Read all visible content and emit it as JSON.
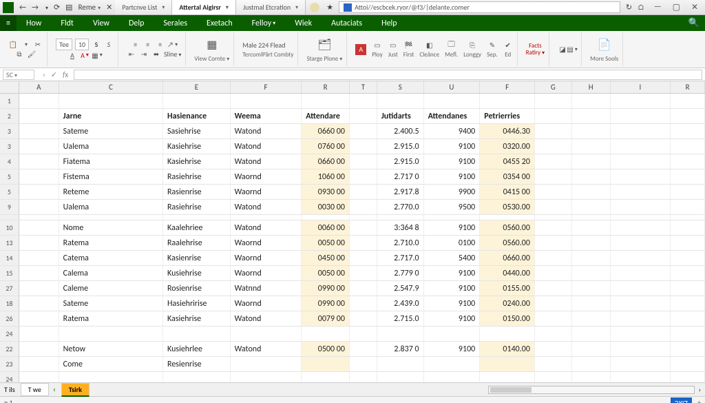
{
  "titlebar": {
    "reme": "Reme",
    "tabs": [
      "Partcnve List",
      "Attertal Aigirsr",
      "Justmal Etcration"
    ],
    "active_tab_index": 1,
    "address": "Attoi//escbcek.ryor/@f3/|delante.comer"
  },
  "ribbon_tabs": [
    "How",
    "Fldt",
    "View",
    "Delp",
    "Serales",
    "Exetach",
    "Felloy",
    "Wiek",
    "Autaciats",
    "Help"
  ],
  "ribbon": {
    "font_name": "Tee",
    "font_size": "10",
    "align_hint": "Sline",
    "view_btn": "View Cornte",
    "male_label": "Male 224 Flead",
    "tercom_label": "TercomlPârt Combty",
    "stage": "Starge Plone",
    "btns": [
      "Ploy",
      "Just",
      "First",
      "Cleânce",
      "Mefl.",
      "Longgy",
      "Sep.",
      "Ed"
    ],
    "facts1": "Facts",
    "facts2": "Ratiry",
    "more": "More Sools"
  },
  "formula": {
    "namebox": "SC"
  },
  "columns": [
    "A",
    "C",
    "E",
    "F",
    "R",
    "T",
    "S",
    "U",
    "F",
    "G",
    "H",
    "I",
    "R"
  ],
  "headers": {
    "jarne": "Jarne",
    "hasienance": "Hasienance",
    "weema": "Weema",
    "attendare": "Attendare",
    "jutidarts": "Jutidarts",
    "attendanes": "Attendanes",
    "petrierries": "Petrierries"
  },
  "rows": [
    {
      "rh": "1",
      "blank": true
    },
    {
      "rh": "2",
      "header": true
    },
    {
      "rh": "3",
      "c": "Sateme",
      "e": "Sasiehrise",
      "f": "Watond",
      "r": "0660 00",
      "s": "2.400.5",
      "u": "9400",
      "ff": "0446.30"
    },
    {
      "rh": "3",
      "c": "Ualema",
      "e": "Kasiehrise",
      "f": "Watond",
      "r": "0760 00",
      "s": "2.915.0",
      "u": "9100",
      "ff": "0320.00"
    },
    {
      "rh": "4",
      "c": "Fiatema",
      "e": "Kasiehrise",
      "f": "Watond",
      "r": "0660 00",
      "s": "2.915.0",
      "u": "9100",
      "ff": "0455 20"
    },
    {
      "rh": "5",
      "c": "Fistema",
      "e": "Rasiehrise",
      "f": "Waornd",
      "r": "1060 00",
      "s": "2.717 0",
      "u": "9100",
      "ff": "0354 00"
    },
    {
      "rh": "5",
      "c": "Reteme",
      "e": "Rasienrise",
      "f": "Waornd",
      "r": "0930 00",
      "s": "2.917.8",
      "u": "9900",
      "ff": "0415 00"
    },
    {
      "rh": "9",
      "c": "Ualema",
      "e": "Rasiehrise",
      "f": "Watond",
      "r": "0030 00",
      "s": "2.770.0",
      "u": "9500",
      "ff": "0530.00"
    },
    {
      "rh": "",
      "blank": true,
      "short": true
    },
    {
      "rh": "10",
      "c": "Nome",
      "e": "Kaalehriee",
      "f": "Watond",
      "r": "0060 00",
      "s": "3:364 8",
      "u": "9100",
      "ff": "0560.00"
    },
    {
      "rh": "13",
      "c": "Ratema",
      "e": "Raalehrise",
      "f": "Waornd",
      "r": "0050 00",
      "s": "2.710.0",
      "u": "0100",
      "ff": "0560.00"
    },
    {
      "rh": "14",
      "c": "Catema",
      "e": "Kasienrise",
      "f": "Waornd",
      "r": "0450 00",
      "s": "2.717.0",
      "u": "5400",
      "ff": "0660.00"
    },
    {
      "rh": "15",
      "c": "Calema",
      "e": "Kusiehrise",
      "f": "Waornd",
      "r": "0050 00",
      "s": "2.779 0",
      "u": "9100",
      "ff": "0440.00"
    },
    {
      "rh": "27",
      "c": "Caleme",
      "e": "Rosienrise",
      "f": "Watnnd",
      "r": "0990 00",
      "s": "2.547.9",
      "u": "9100",
      "ff": "0155.00"
    },
    {
      "rh": "18",
      "c": "Sateme",
      "e": "Hasiehririse",
      "f": "Waornd",
      "r": "0990 00",
      "s": "2.439.0",
      "u": "9100",
      "ff": "0240.00"
    },
    {
      "rh": "26",
      "c": "Ratema",
      "e": "Kasiehrise",
      "f": "Watond",
      "r": "0079 00",
      "s": "2.715.0",
      "u": "9100",
      "ff": "0150.00"
    },
    {
      "rh": "24",
      "blank": true
    },
    {
      "rh": "22",
      "c": "Netow",
      "e": "Kusiehrlee",
      "f": "Watond",
      "r": "0500 00",
      "s": "2.837 0",
      "u": "9100",
      "ff": "0140.00"
    },
    {
      "rh": "23",
      "c": "Come",
      "e": "Resienrise",
      "f": "",
      "r": "",
      "s": "",
      "u": "",
      "ff": ""
    },
    {
      "rh": "24",
      "blank": true
    }
  ],
  "sheets": {
    "left_label": "T ils",
    "tab1": "T we",
    "tab2": "Tsirk"
  },
  "status": {
    "left": "n 1",
    "zoom": "דוצר"
  }
}
